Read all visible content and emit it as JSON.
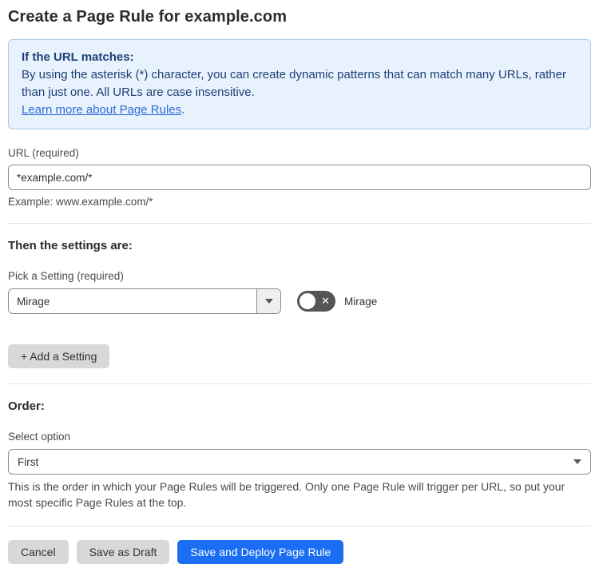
{
  "page": {
    "title": "Create a Page Rule for example.com"
  },
  "info_box": {
    "heading": "If the URL matches:",
    "body": "By using the asterisk (*) character, you can create dynamic patterns that can match many URLs, rather than just one. All URLs are case insensitive.",
    "link_label": "Learn more about Page Rules",
    "link_suffix": "."
  },
  "url_field": {
    "label": "URL (required)",
    "value": "*example.com/*",
    "helper": "Example: www.example.com/*"
  },
  "settings_section": {
    "heading": "Then the settings are:",
    "picker_label": "Pick a Setting (required)",
    "selected_setting": "Mirage",
    "toggle_state": "off",
    "toggle_icon": "✕",
    "toggle_label": "Mirage",
    "add_setting_label": "+ Add a Setting"
  },
  "order_section": {
    "heading": "Order:",
    "select_label": "Select option",
    "selected_option": "First",
    "helper": "This is the order in which your Page Rules will be triggered. Only one Page Rule will trigger per URL, so put your most specific Page Rules at the top."
  },
  "footer": {
    "cancel_label": "Cancel",
    "save_draft_label": "Save as Draft",
    "save_deploy_label": "Save and Deploy Page Rule"
  },
  "colors": {
    "accent_blue": "#1b6ef3",
    "info_background": "#e8f2fc",
    "info_border": "#a9c9ef",
    "info_text": "#1e3f77",
    "link_blue": "#2f6bd8",
    "toggle_off_gray": "#555555"
  }
}
